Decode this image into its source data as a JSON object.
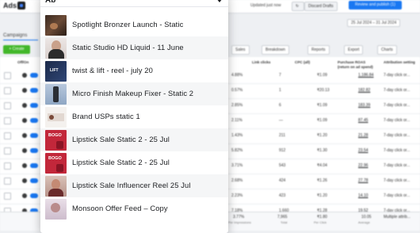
{
  "topbar": {
    "brand": "Ads",
    "status": "Updated just now",
    "discard_label": "Discard Drafts",
    "publish_label": "Review and publish (1)",
    "date_range": "25 Jul 2024 – 31 Jul 2024"
  },
  "nav": {
    "campaigns_tab": "Campaigns",
    "create_label": "+ Create",
    "sales_label": "Sales",
    "breakdown_label": "Breakdown",
    "reports_label": "Reports",
    "export_label": "Export",
    "charts_label": "Charts"
  },
  "table": {
    "headers": [
      "Off/On",
      "Link clicks",
      "CPC (all)",
      "Purchase ROAS (return on ad spend)",
      "Attribution setting"
    ],
    "rows": [
      {
        "pct": "4.88%",
        "clicks": "7",
        "cpc": "₹1.09",
        "roas": "1,186.84",
        "attr": "7-day click or..."
      },
      {
        "pct": "0.57%",
        "clicks": "1",
        "cpc": "₹20.13",
        "roas": "182.82",
        "attr": "7-day click or..."
      },
      {
        "pct": "2.85%",
        "clicks": "6",
        "cpc": "₹1.09",
        "roas": "183.39",
        "attr": "7-day click or..."
      },
      {
        "pct": "2.11%",
        "clicks": "—",
        "cpc": "₹1.09",
        "roas": "87.45",
        "attr": "7-day click or..."
      },
      {
        "pct": "1.43%",
        "clicks": "211",
        "cpc": "₹1.20",
        "roas": "21.28",
        "attr": "7-day click or..."
      },
      {
        "pct": "5.82%",
        "clicks": "912",
        "cpc": "₹1.30",
        "roas": "23.54",
        "attr": "7-day click or..."
      },
      {
        "pct": "3.71%",
        "clicks": "543",
        "cpc": "₹4.04",
        "roas": "22.96",
        "attr": "7-day click or..."
      },
      {
        "pct": "2.68%",
        "clicks": "424",
        "cpc": "₹1.26",
        "roas": "27.78",
        "attr": "7-day click or..."
      },
      {
        "pct": "2.23%",
        "clicks": "423",
        "cpc": "₹1.20",
        "roas": "14.10",
        "attr": "7-day click or..."
      },
      {
        "pct": "7.18%",
        "clicks": "1,660",
        "cpc": "₹1.28",
        "roas": "19.52",
        "attr": "7-day click or..."
      }
    ],
    "totals": {
      "pct": "3.77%",
      "pct_sub": "Per Impressions",
      "clicks": "7,965",
      "clicks_sub": "Total",
      "cpc": "₹1.80",
      "cpc_sub": "Per Click",
      "roas": "10.05",
      "roas_sub": "Average",
      "attr": "Multiple attrib..."
    }
  },
  "dropdown": {
    "query": "Ab",
    "items": [
      "Spotlight Bronzer Launch - Static",
      "Static Studio HD Liquid - 11 June",
      "twist & lift - reel - july 20",
      "Micro Finish Makeup Fixer - Static 2",
      "Brand USPs static 1",
      "Lipstick Sale Static 2 - 25 Jul",
      "Lipstick Sale Static 2 - 25 Jul",
      "Lipstick Sale Influencer Reel 25 Jul",
      "Monsoon Offer Feed – Copy"
    ],
    "bogo_text": "BOGO",
    "brand_badge": "LIFT"
  },
  "colors": {
    "accent": "#1877f2",
    "create": "#42b72a",
    "bogo": "#c2273a"
  }
}
